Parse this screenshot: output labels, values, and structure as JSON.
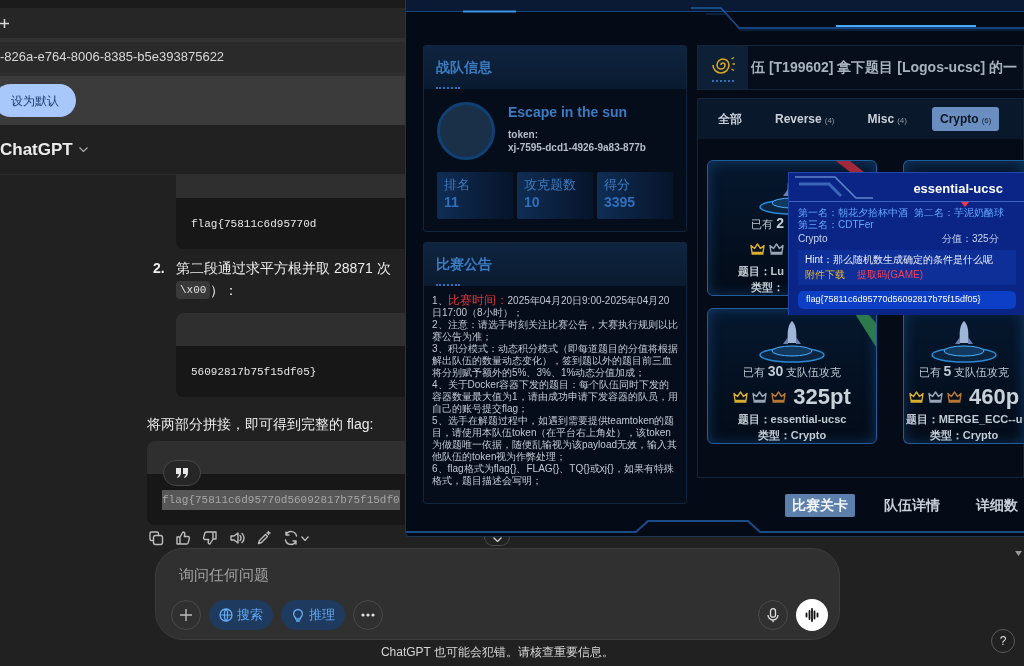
{
  "browser": {
    "conversation_id": "-826a-e764-8006-8385-b5e393875622",
    "default_button": "设为默认"
  },
  "chat": {
    "title": "ChatGPT",
    "answer": [
      {
        "kind": "list_item",
        "children": [
          {
            "kind": "code",
            "text": "flag{75811c6d95770d",
            "selected": false
          }
        ]
      },
      {
        "kind": "list_item",
        "number": "2.",
        "text": "第二段通过求平方根并取 28871 次",
        "code": "\\x00",
        "tail": "）：",
        "children": [
          {
            "kind": "code",
            "text": "56092817b75f15df05}",
            "selected": false
          }
        ]
      },
      {
        "kind": "paragraph",
        "text": "将两部分拼接，即可得到完整的 flag:"
      },
      {
        "kind": "code",
        "text": "flag{75811c6d95770d56092817b75f15df0",
        "selected": true,
        "quote_button": true
      }
    ]
  },
  "composer": {
    "placeholder": "询问任何问题",
    "tools": [
      {
        "kind": "web",
        "label": "搜索"
      },
      {
        "kind": "reason",
        "label": "推理"
      }
    ],
    "disclaimer": "ChatGPT 也可能会犯错。请核查重要信息。"
  },
  "help_button": "?",
  "ctf": {
    "team": {
      "title": "战队信息",
      "name": "Escape in the sun",
      "token_label": "token:",
      "token": "xj-7595-dcd1-4926-9a83-877b",
      "stats": [
        {
          "label": "排名",
          "value": "11"
        },
        {
          "label": "攻克题数",
          "value": "10"
        },
        {
          "label": "得分",
          "value": "3395"
        }
      ]
    },
    "notice": {
      "title": "比赛公告",
      "items": [
        "1、**比赛时间：**2025年04月20日9:00-2025年04月20日17:00（8小时）；",
        "2、注意：请选手时刻关注比赛公告，大赛执行规则以比赛公告为准；",
        "3、积分模式：动态积分模式（即每道题目的分值将根据解出队伍的数量动态变化），签到题以外的题目前三血将分别赋予额外的5%、3%、1%动态分值加成；",
        "4、关于Docker容器下发的题目：每个队伍同时下发的容器数量最大值为1，请由成功申请下发容器的队员，用自己的账号提交flag；",
        "5、选手在解题过程中，如遇到需要提供teamtoken的题目，请使用本队伍token（在平台右上角处），该token为做题唯一依据，随便乱输视为该payload无效，输入其他队伍的token视为作弊处理；",
        "6、flag格式为flag{}、FLAG{}、TQ{}或xj{}，如果有特殊格式，题目描述会写明；"
      ]
    },
    "feed": "伍 [T199602] 拿下题目 [Logos-ucsc] 的一",
    "tabs": [
      {
        "label": "全部",
        "selected": false
      },
      {
        "label": "Reverse",
        "count": "(4)",
        "selected": false
      },
      {
        "label": "Misc",
        "count": "(4)",
        "selected": false
      },
      {
        "label": "Crypto",
        "count": "(6)",
        "selected": true
      }
    ],
    "challenges": [
      {
        "kind": "partial",
        "solved": "已有 **2**",
        "crowns": [
          {
            "color": "#d9ad2f"
          },
          {
            "color": "#9aa6b6"
          }
        ],
        "name": "题目：Lu",
        "type": "类型：",
        "ribbon": {
          "color": "#a3283a"
        }
      },
      {
        "kind": "covered"
      },
      {
        "kind": "full",
        "solved": "已有 **30** 支队伍攻克",
        "crowns": [
          {
            "color": "#d9ad2f"
          },
          {
            "color": "#9aa6b6"
          },
          {
            "color": "#b87632"
          }
        ],
        "points": "325pt",
        "name": "题目：essential-ucsc",
        "type": "类型：Crypto",
        "ribbon": {
          "color": "#2c7a4b"
        }
      },
      {
        "kind": "full",
        "solved": "已有 **5** 支队伍攻克",
        "crowns": [
          {
            "color": "#d9ad2f"
          },
          {
            "color": "#9aa6b6"
          },
          {
            "color": "#b87632"
          }
        ],
        "points": "460p",
        "name": "题目：MERGE_ECC--u",
        "type": "类型：Crypto"
      }
    ],
    "popup": {
      "title": "essential-ucsc",
      "ranks": [
        "第一名：朝花夕拾杯中酒",
        "第二名：芋泥奶酪球",
        "第三名：CDTFer"
      ],
      "category": "Crypto",
      "points": "分值：325分",
      "hint": "Hint：那么随机数生成确定的条件是什么呢",
      "download": "附件下载",
      "extract_code": "提取码(GAME)",
      "flag": "flag{75811c6d95770d56092817b75f15df05}"
    },
    "nav": [
      {
        "label": "比赛关卡",
        "selected": true
      },
      {
        "label": "队伍详情",
        "selected": false
      },
      {
        "label": "详细数",
        "selected": false
      }
    ]
  }
}
